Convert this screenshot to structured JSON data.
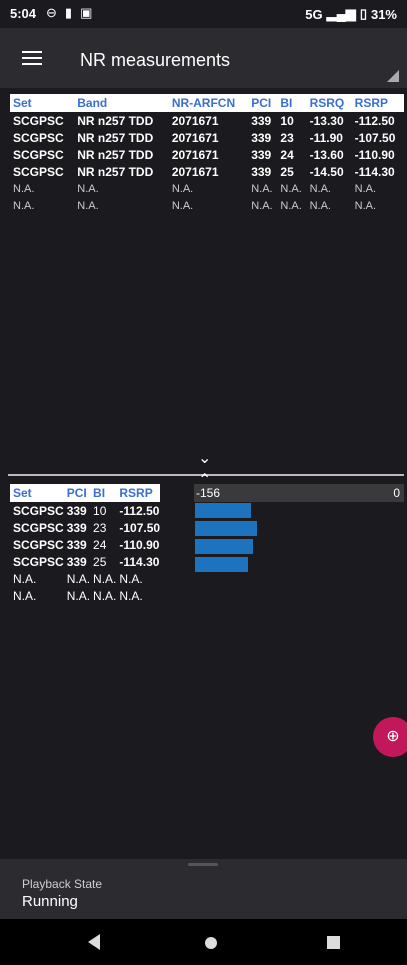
{
  "status_bar": {
    "time": "5:04",
    "network": "5G",
    "battery": "31%"
  },
  "app_bar": {
    "title": "NR measurements"
  },
  "table1": {
    "headers": [
      "Set",
      "Band",
      "NR-ARFCN",
      "PCI",
      "BI",
      "RSRQ",
      "RSRP"
    ],
    "rows": [
      [
        "SCGPSC",
        "NR n257 TDD",
        "2071671",
        "339",
        "10",
        "-13.30",
        "-112.50"
      ],
      [
        "SCGPSC",
        "NR n257 TDD",
        "2071671",
        "339",
        "23",
        "-11.90",
        "-107.50"
      ],
      [
        "SCGPSC",
        "NR n257 TDD",
        "2071671",
        "339",
        "24",
        "-13.60",
        "-110.90"
      ],
      [
        "SCGPSC",
        "NR n257 TDD",
        "2071671",
        "339",
        "25",
        "-14.50",
        "-114.30"
      ],
      [
        "N.A.",
        "N.A.",
        "N.A.",
        "N.A.",
        "N.A.",
        "N.A.",
        "N.A."
      ],
      [
        "N.A.",
        "N.A.",
        "N.A.",
        "N.A.",
        "N.A.",
        "N.A.",
        "N.A."
      ]
    ]
  },
  "table2": {
    "headers": [
      "Set",
      "PCI",
      "BI",
      "RSRP"
    ],
    "rows": [
      [
        "SCGPSC",
        "339",
        "10",
        "-112.50"
      ],
      [
        "SCGPSC",
        "339",
        "23",
        "-107.50"
      ],
      [
        "SCGPSC",
        "339",
        "24",
        "-110.90"
      ],
      [
        "SCGPSC",
        "339",
        "25",
        "-114.30"
      ],
      [
        "N.A.",
        "N.A.",
        "N.A.",
        "N.A."
      ],
      [
        "N.A.",
        "N.A.",
        "N.A.",
        "N.A."
      ]
    ]
  },
  "rsrp_bars": {
    "scale_min_label": "-156",
    "scale_max_label": "0",
    "scale_min": -156,
    "scale_max": 0,
    "values": [
      -112.5,
      -107.5,
      -110.9,
      -114.3
    ],
    "color": "#1e73be"
  },
  "playback": {
    "label": "Playback State",
    "value": "Running"
  },
  "colors": {
    "header_text": "#3a6fd1",
    "fab": "#c2185b"
  }
}
